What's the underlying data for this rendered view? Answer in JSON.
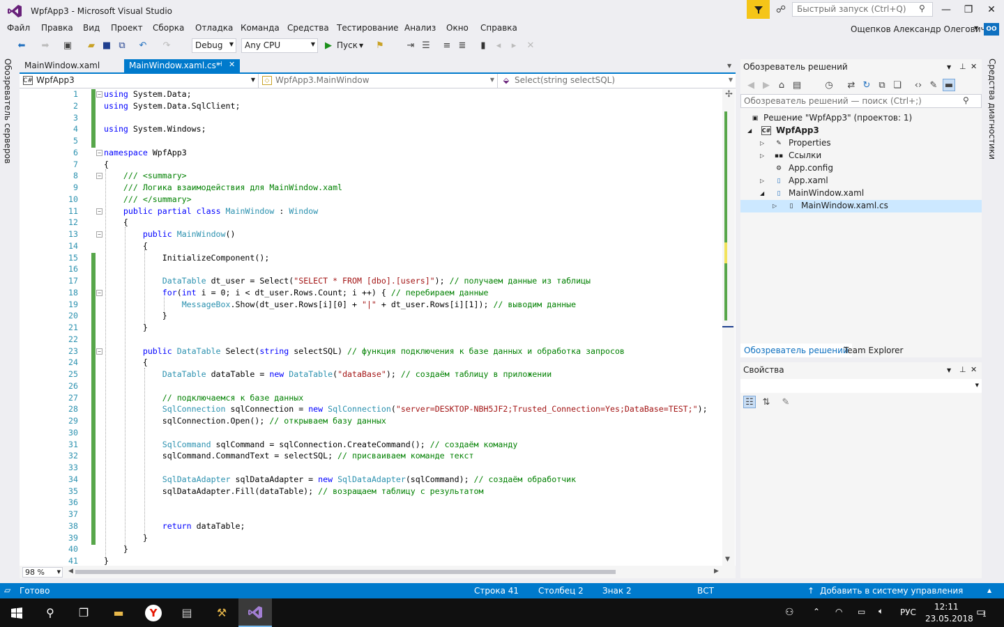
{
  "window": {
    "title": "WpfApp3 - Microsoft Visual Studio",
    "quick_launch_placeholder": "Быстрый запуск (Ctrl+Q)",
    "user_name": "Ощепков Александр Олегович",
    "user_initials": "OO"
  },
  "menu": [
    "Файл",
    "Правка",
    "Вид",
    "Проект",
    "Сборка",
    "Отладка",
    "Команда",
    "Средства",
    "Тестирование",
    "Анализ",
    "Окно",
    "Справка"
  ],
  "toolbar": {
    "config": "Debug",
    "platform": "Any CPU",
    "run_label": "Пуск"
  },
  "server_explorer_label": "Обозреватель серверов",
  "diagnostics_label": "Средства диагностики",
  "editor": {
    "tabs": [
      {
        "label": "MainWindow.xaml",
        "active": false
      },
      {
        "label": "MainWindow.xaml.cs*",
        "active": true
      }
    ],
    "nav": {
      "project": "WpfApp3",
      "class": "WpfApp3.MainWindow",
      "member": "Select(string selectSQL)"
    },
    "zoom": "98 %",
    "lines": [
      {
        "n": "1",
        "t": "using System.Data;"
      },
      {
        "n": "2",
        "t": "using System.Data.SqlClient;"
      },
      {
        "n": "3",
        "t": ""
      },
      {
        "n": "4",
        "t": "using System.Windows;"
      },
      {
        "n": "5",
        "t": ""
      },
      {
        "n": "6",
        "t": "namespace WpfApp3"
      },
      {
        "n": "7",
        "t": "{"
      },
      {
        "n": "8",
        "t": "    /// <summary>"
      },
      {
        "n": "9",
        "t": "    /// Логика взаимодействия для MainWindow.xaml"
      },
      {
        "n": "10",
        "t": "    /// </summary>"
      },
      {
        "n": "11",
        "t": "    public partial class MainWindow : Window"
      },
      {
        "n": "12",
        "t": "    {"
      },
      {
        "n": "13",
        "t": "        public MainWindow()"
      },
      {
        "n": "14",
        "t": "        {"
      },
      {
        "n": "15",
        "t": "            InitializeComponent();"
      },
      {
        "n": "16",
        "t": ""
      },
      {
        "n": "17",
        "t": "            DataTable dt_user = Select(\"SELECT * FROM [dbo].[users]\"); // получаем данные из таблицы"
      },
      {
        "n": "18",
        "t": "            for(int i = 0; i < dt_user.Rows.Count; i ++) { // перебираем данные"
      },
      {
        "n": "19",
        "t": "                MessageBox.Show(dt_user.Rows[i][0] + \"|\" + dt_user.Rows[i][1]); // выводим данные"
      },
      {
        "n": "20",
        "t": "            }"
      },
      {
        "n": "21",
        "t": "        }"
      },
      {
        "n": "22",
        "t": ""
      },
      {
        "n": "23",
        "t": "        public DataTable Select(string selectSQL) // функция подключения к базе данных и обработка запросов"
      },
      {
        "n": "24",
        "t": "        {"
      },
      {
        "n": "25",
        "t": "            DataTable dataTable = new DataTable(\"dataBase\"); // создаём таблицу в приложении"
      },
      {
        "n": "26",
        "t": ""
      },
      {
        "n": "27",
        "t": "            // подключаемся к базе данных"
      },
      {
        "n": "28",
        "t": "            SqlConnection sqlConnection = new SqlConnection(\"server=DESKTOP-NBH5JF2;Trusted_Connection=Yes;DataBase=TEST;\");"
      },
      {
        "n": "29",
        "t": "            sqlConnection.Open(); // открываем базу данных"
      },
      {
        "n": "30",
        "t": ""
      },
      {
        "n": "31",
        "t": "            SqlCommand sqlCommand = sqlConnection.CreateCommand(); // создаём команду"
      },
      {
        "n": "32",
        "t": "            sqlCommand.CommandText = selectSQL; // присваиваем команде текст"
      },
      {
        "n": "33",
        "t": ""
      },
      {
        "n": "34",
        "t": "            SqlDataAdapter sqlDataAdapter = new SqlDataAdapter(sqlCommand); // создаём обработчик"
      },
      {
        "n": "35",
        "t": "            sqlDataAdapter.Fill(dataTable); // возращаем таблицу с результатом"
      },
      {
        "n": "36",
        "t": ""
      },
      {
        "n": "37",
        "t": ""
      },
      {
        "n": "38",
        "t": "            return dataTable;"
      },
      {
        "n": "39",
        "t": "        }"
      },
      {
        "n": "40",
        "t": "    }"
      },
      {
        "n": "41",
        "t": "}"
      }
    ]
  },
  "solution_explorer": {
    "title": "Обозреватель решений",
    "search_placeholder": "Обозреватель решений — поиск (Ctrl+;)",
    "items": [
      {
        "label": "Решение \"WpfApp3\"  (проектов: 1)",
        "icon": "solution-icon"
      },
      {
        "label": "WpfApp3",
        "icon": "csharp-project-icon"
      },
      {
        "label": "Properties",
        "icon": "wrench-icon"
      },
      {
        "label": "Ссылки",
        "icon": "references-icon"
      },
      {
        "label": "App.config",
        "icon": "config-file-icon"
      },
      {
        "label": "App.xaml",
        "icon": "xaml-file-icon"
      },
      {
        "label": "MainWindow.xaml",
        "icon": "xaml-file-icon"
      },
      {
        "label": "MainWindow.xaml.cs",
        "icon": "cs-file-icon"
      }
    ],
    "tabs": [
      "Обозреватель решений",
      "Team Explorer"
    ]
  },
  "properties": {
    "title": "Свойства"
  },
  "statusbar": {
    "ready": "Готово",
    "line": "Строка 41",
    "column": "Столбец 2",
    "char": "Знак 2",
    "mode": "ВСТ",
    "source_control": "Добавить в систему управления версиями"
  },
  "taskbar": {
    "lang": "РУС",
    "time": "12:11",
    "date": "23.05.2018",
    "notifications": "1"
  },
  "colors": {
    "accent": "#007acc",
    "vs_purple": "#68217a",
    "keyword": "#0000ff",
    "type": "#2b91af",
    "string": "#a31515",
    "comment": "#008000",
    "change_bar": "#57a64a"
  }
}
